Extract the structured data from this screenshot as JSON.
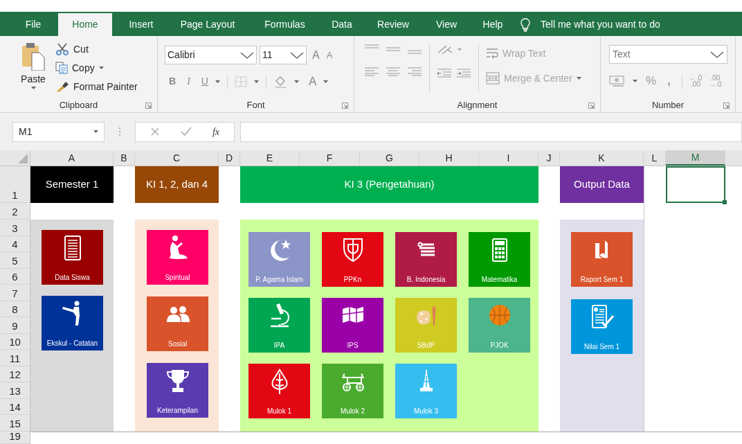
{
  "ribbon": {
    "tabs": [
      {
        "label": "File",
        "selected": false
      },
      {
        "label": "Home",
        "selected": true
      },
      {
        "label": "Insert",
        "selected": false
      },
      {
        "label": "Page Layout",
        "selected": false
      },
      {
        "label": "Formulas",
        "selected": false
      },
      {
        "label": "Data",
        "selected": false
      },
      {
        "label": "Review",
        "selected": false
      },
      {
        "label": "View",
        "selected": false
      },
      {
        "label": "Help",
        "selected": false
      }
    ],
    "tell_me": "Tell me what you want to do",
    "clipboard": {
      "paste": "Paste",
      "cut": "Cut",
      "copy": "Copy",
      "format_painter": "Format Painter",
      "group": "Clipboard"
    },
    "font": {
      "font_name": "Calibri",
      "font_size": "11",
      "grow": "A",
      "shrink": "A",
      "bold": "B",
      "italic": "I",
      "underline": "U",
      "font_color": "A",
      "group": "Font"
    },
    "alignment": {
      "wrap_text": {
        "label": "Wrap Text",
        "disabled": true
      },
      "merge_center": {
        "label": "Merge & Center",
        "disabled": true
      },
      "group": "Alignment"
    },
    "number": {
      "format": "Text",
      "percent": "%",
      "comma": ",",
      "decrease_decimal": {
        "top": "←.0",
        "bottom": ".00"
      },
      "increase_decimal": {
        "top": ".00",
        "bottom": "→.0"
      },
      "group": "Number"
    }
  },
  "formula_bar": {
    "name_box": "M1",
    "fx": "fx"
  },
  "sheet": {
    "columns": [
      {
        "label": "A",
        "selected": false
      },
      {
        "label": "B",
        "selected": false
      },
      {
        "label": "C",
        "selected": false
      },
      {
        "label": "D",
        "selected": false
      },
      {
        "label": "E",
        "selected": false
      },
      {
        "label": "F",
        "selected": false
      },
      {
        "label": "G",
        "selected": false
      },
      {
        "label": "H",
        "selected": false
      },
      {
        "label": "I",
        "selected": false
      },
      {
        "label": "J",
        "selected": false
      },
      {
        "label": "K",
        "selected": false
      },
      {
        "label": "L",
        "selected": false
      },
      {
        "label": "M",
        "selected": true
      }
    ],
    "rows": [
      "1",
      "2",
      "3",
      "4",
      "5",
      "6",
      "7",
      "8",
      "9",
      "10",
      "11",
      "12",
      "13",
      "14",
      "15",
      "19"
    ],
    "sections": [
      {
        "title": "Semester 1",
        "color": "#000000",
        "panel": {
          "color": "#d9d9d9"
        },
        "tiles": [
          {
            "label": "Data Siswa",
            "color": "#990000"
          },
          {
            "label": "Ekskul - Catatan",
            "color": "#003399"
          }
        ]
      },
      {
        "title": "KI 1, 2, dan 4",
        "color": "#974706",
        "panel": {
          "color": "#fbe5d6"
        },
        "tiles": [
          {
            "label": "Spiritual",
            "color": "#ff0066"
          },
          {
            "label": "Sosial",
            "color": "#d9532b"
          },
          {
            "label": "Keterampilan",
            "color": "#5a3bb0"
          }
        ]
      },
      {
        "title": "KI 3 (Pengetahuan)",
        "color": "#00b050",
        "panel": {
          "color": "#ccff99"
        },
        "tiles": [
          {
            "label": "P. Agama Islam",
            "color": "#8c95c8"
          },
          {
            "label": "PPKn",
            "color": "#e30613"
          },
          {
            "label": "B. Indonesia",
            "color": "#b01c46"
          },
          {
            "label": "Matematika",
            "color": "#009a00"
          },
          {
            "label": "IPA",
            "color": "#00a651"
          },
          {
            "label": "IPS",
            "color": "#9a00a8"
          },
          {
            "label": "SBdP",
            "color": "#cfcb22"
          },
          {
            "label": "PJOK",
            "color": "#4cb58c"
          },
          {
            "label": "Mulok 1",
            "color": "#e30613"
          },
          {
            "label": "Mulok 2",
            "color": "#4aab2e"
          },
          {
            "label": "Mulok 3",
            "color": "#35bdef"
          }
        ]
      },
      {
        "title": "Output Data",
        "color": "#7030a0",
        "panel": {
          "color": "#e1dfec"
        },
        "tiles": [
          {
            "label": "Raport Sem 1",
            "color": "#d9532b"
          },
          {
            "label": "Nilai Sem 1",
            "color": "#0096db"
          }
        ]
      }
    ]
  }
}
